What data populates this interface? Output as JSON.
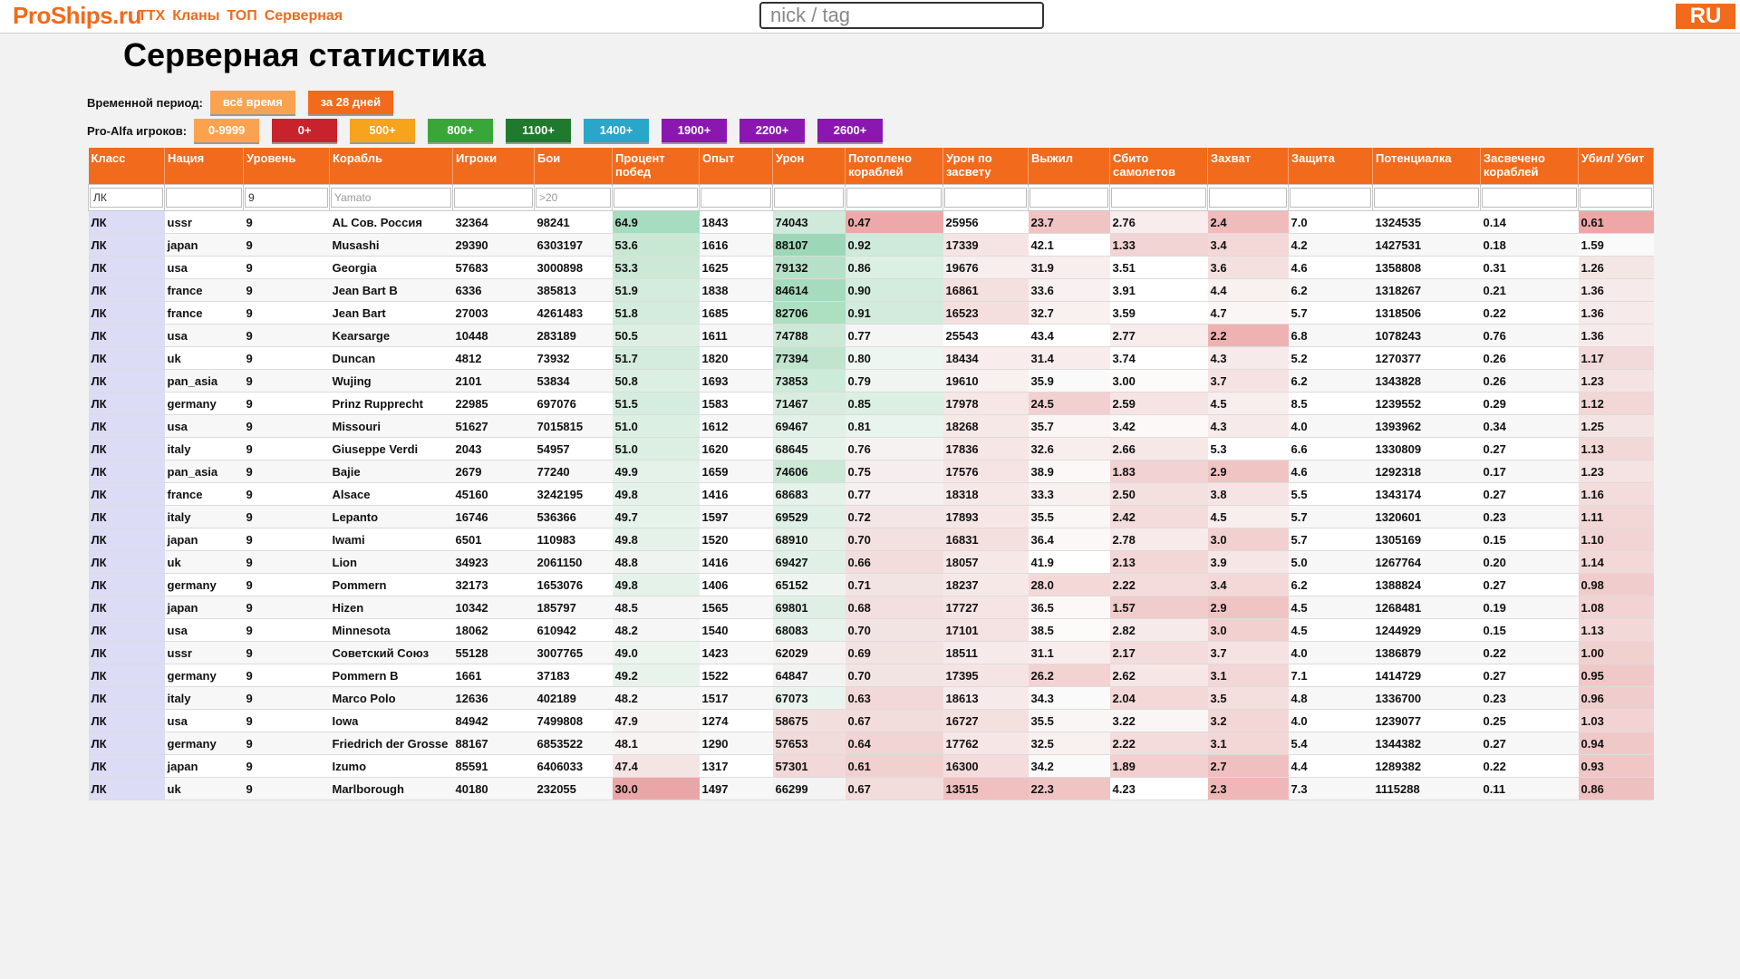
{
  "header": {
    "logo": "ProShips.ru",
    "nav": [
      "ТТХ",
      "Кланы",
      "ТОП",
      "Серверная"
    ],
    "search_placeholder": "nick / tag",
    "lang": "RU"
  },
  "page_title": "Серверная статистика",
  "period": {
    "label": "Временной период:",
    "buttons": [
      {
        "label": "всё время",
        "color": "#f9a350"
      },
      {
        "label": "за 28 дней",
        "color": "#f26a1b"
      }
    ]
  },
  "alfa": {
    "label": "Pro-Alfa игроков:",
    "buttons": [
      {
        "label": "0-9999",
        "color": "#f9a350"
      },
      {
        "label": "0+",
        "color": "#c8232c"
      },
      {
        "label": "500+",
        "color": "#f7a31b"
      },
      {
        "label": "800+",
        "color": "#3aa63a"
      },
      {
        "label": "1100+",
        "color": "#1f7a2e"
      },
      {
        "label": "1400+",
        "color": "#2aa6c9"
      },
      {
        "label": "1900+",
        "color": "#8a18b0"
      },
      {
        "label": "2200+",
        "color": "#8a18b0"
      },
      {
        "label": "2600+",
        "color": "#8a18b0"
      }
    ]
  },
  "table": {
    "columns": [
      "Класс",
      "Нация",
      "Уровень",
      "Корабль",
      "Игроки",
      "Бои",
      "Процент побед",
      "Опыт",
      "Урон",
      "Потоплено кораблей",
      "Урон по засвету",
      "Выжил",
      "Сбито самолетов",
      "Захват",
      "Защита",
      "Потенциалка",
      "Засвечено кораблей",
      "Убил/ Убит"
    ],
    "filters": [
      "ЛК",
      "",
      "9",
      "",
      "",
      "",
      "",
      "",
      "",
      "",
      "",
      "",
      "",
      "",
      "",
      "",
      "",
      ""
    ],
    "filter_placeholders": [
      "",
      "",
      "",
      "Yamato",
      "",
      ">20",
      "",
      "",
      "",
      "",
      "",
      "",
      "",
      "",
      "",
      "",
      "",
      ""
    ],
    "rows": [
      [
        "ЛК",
        "ussr",
        "9",
        "AL Сов. Россия",
        "32364",
        "98241",
        "64.9",
        "1843",
        "74043",
        "0.47",
        "25956",
        "23.7",
        "2.76",
        "2.4",
        "7.0",
        "1324535",
        "0.14",
        "0.61"
      ],
      [
        "ЛК",
        "japan",
        "9",
        "Musashi",
        "29390",
        "6303197",
        "53.6",
        "1616",
        "88107",
        "0.92",
        "17339",
        "42.1",
        "1.33",
        "3.4",
        "4.2",
        "1427531",
        "0.18",
        "1.59"
      ],
      [
        "ЛК",
        "usa",
        "9",
        "Georgia",
        "57683",
        "3000898",
        "53.3",
        "1625",
        "79132",
        "0.86",
        "19676",
        "31.9",
        "3.51",
        "3.6",
        "4.6",
        "1358808",
        "0.31",
        "1.26"
      ],
      [
        "ЛК",
        "france",
        "9",
        "Jean Bart B",
        "6336",
        "385813",
        "51.9",
        "1838",
        "84614",
        "0.90",
        "16861",
        "33.6",
        "3.91",
        "4.4",
        "6.2",
        "1318267",
        "0.21",
        "1.36"
      ],
      [
        "ЛК",
        "france",
        "9",
        "Jean Bart",
        "27003",
        "4261483",
        "51.8",
        "1685",
        "82706",
        "0.91",
        "16523",
        "32.7",
        "3.59",
        "4.7",
        "5.7",
        "1318506",
        "0.22",
        "1.36"
      ],
      [
        "ЛК",
        "usa",
        "9",
        "Kearsarge",
        "10448",
        "283189",
        "50.5",
        "1611",
        "74788",
        "0.77",
        "25543",
        "43.4",
        "2.77",
        "2.2",
        "6.8",
        "1078243",
        "0.76",
        "1.36"
      ],
      [
        "ЛК",
        "uk",
        "9",
        "Duncan",
        "4812",
        "73932",
        "51.7",
        "1820",
        "77394",
        "0.80",
        "18434",
        "31.4",
        "3.74",
        "4.3",
        "5.2",
        "1270377",
        "0.26",
        "1.17"
      ],
      [
        "ЛК",
        "pan_asia",
        "9",
        "Wujing",
        "2101",
        "53834",
        "50.8",
        "1693",
        "73853",
        "0.79",
        "19610",
        "35.9",
        "3.00",
        "3.7",
        "6.2",
        "1343828",
        "0.26",
        "1.23"
      ],
      [
        "ЛК",
        "germany",
        "9",
        "Prinz Rupprecht",
        "22985",
        "697076",
        "51.5",
        "1583",
        "71467",
        "0.85",
        "17978",
        "24.5",
        "2.59",
        "4.5",
        "8.5",
        "1239552",
        "0.29",
        "1.12"
      ],
      [
        "ЛК",
        "usa",
        "9",
        "Missouri",
        "51627",
        "7015815",
        "51.0",
        "1612",
        "69467",
        "0.81",
        "18268",
        "35.7",
        "3.42",
        "4.3",
        "4.0",
        "1393962",
        "0.34",
        "1.25"
      ],
      [
        "ЛК",
        "italy",
        "9",
        "Giuseppe Verdi",
        "2043",
        "54957",
        "51.0",
        "1620",
        "68645",
        "0.76",
        "17836",
        "32.6",
        "2.66",
        "5.3",
        "6.6",
        "1330809",
        "0.27",
        "1.13"
      ],
      [
        "ЛК",
        "pan_asia",
        "9",
        "Bajie",
        "2679",
        "77240",
        "49.9",
        "1659",
        "74606",
        "0.75",
        "17576",
        "38.9",
        "1.83",
        "2.9",
        "4.6",
        "1292318",
        "0.17",
        "1.23"
      ],
      [
        "ЛК",
        "france",
        "9",
        "Alsace",
        "45160",
        "3242195",
        "49.8",
        "1416",
        "68683",
        "0.77",
        "18318",
        "33.3",
        "2.50",
        "3.8",
        "5.5",
        "1343174",
        "0.27",
        "1.16"
      ],
      [
        "ЛК",
        "italy",
        "9",
        "Lepanto",
        "16746",
        "536366",
        "49.7",
        "1597",
        "69529",
        "0.72",
        "17893",
        "35.5",
        "2.42",
        "4.5",
        "5.7",
        "1320601",
        "0.23",
        "1.11"
      ],
      [
        "ЛК",
        "japan",
        "9",
        "Iwami",
        "6501",
        "110983",
        "49.8",
        "1520",
        "68910",
        "0.70",
        "16831",
        "36.4",
        "2.78",
        "3.0",
        "5.7",
        "1305169",
        "0.15",
        "1.10"
      ],
      [
        "ЛК",
        "uk",
        "9",
        "Lion",
        "34923",
        "2061150",
        "48.8",
        "1416",
        "69427",
        "0.66",
        "18057",
        "41.9",
        "2.13",
        "3.9",
        "5.0",
        "1267764",
        "0.20",
        "1.14"
      ],
      [
        "ЛК",
        "germany",
        "9",
        "Pommern",
        "32173",
        "1653076",
        "49.8",
        "1406",
        "65152",
        "0.71",
        "18237",
        "28.0",
        "2.22",
        "3.4",
        "6.2",
        "1388824",
        "0.27",
        "0.98"
      ],
      [
        "ЛК",
        "japan",
        "9",
        "Hizen",
        "10342",
        "185797",
        "48.5",
        "1565",
        "69801",
        "0.68",
        "17727",
        "36.5",
        "1.57",
        "2.9",
        "4.5",
        "1268481",
        "0.19",
        "1.08"
      ],
      [
        "ЛК",
        "usa",
        "9",
        "Minnesota",
        "18062",
        "610942",
        "48.2",
        "1540",
        "68083",
        "0.70",
        "17101",
        "38.5",
        "2.82",
        "3.0",
        "4.5",
        "1244929",
        "0.15",
        "1.13"
      ],
      [
        "ЛК",
        "ussr",
        "9",
        "Советский Союз",
        "55128",
        "3007765",
        "49.0",
        "1423",
        "62029",
        "0.69",
        "18511",
        "31.1",
        "2.17",
        "3.7",
        "4.0",
        "1386879",
        "0.22",
        "1.00"
      ],
      [
        "ЛК",
        "germany",
        "9",
        "Pommern B",
        "1661",
        "37183",
        "49.2",
        "1522",
        "64847",
        "0.70",
        "17395",
        "26.2",
        "2.62",
        "3.1",
        "7.1",
        "1414729",
        "0.27",
        "0.95"
      ],
      [
        "ЛК",
        "italy",
        "9",
        "Marco Polo",
        "12636",
        "402189",
        "48.2",
        "1517",
        "67073",
        "0.63",
        "18613",
        "34.3",
        "2.04",
        "3.5",
        "4.8",
        "1336700",
        "0.23",
        "0.96"
      ],
      [
        "ЛК",
        "usa",
        "9",
        "Iowa",
        "84942",
        "7499808",
        "47.9",
        "1274",
        "58675",
        "0.67",
        "16727",
        "35.5",
        "3.22",
        "3.2",
        "4.0",
        "1239077",
        "0.25",
        "1.03"
      ],
      [
        "ЛК",
        "germany",
        "9",
        "Friedrich der Grosse",
        "88167",
        "6853522",
        "48.1",
        "1290",
        "57653",
        "0.64",
        "17762",
        "32.5",
        "2.22",
        "3.1",
        "5.4",
        "1344382",
        "0.27",
        "0.94"
      ],
      [
        "ЛК",
        "japan",
        "9",
        "Izumo",
        "85591",
        "6406033",
        "47.4",
        "1317",
        "57301",
        "0.61",
        "16300",
        "34.2",
        "1.89",
        "2.7",
        "4.4",
        "1289382",
        "0.22",
        "0.93"
      ],
      [
        "ЛК",
        "uk",
        "9",
        "Marlborough",
        "40180",
        "232055",
        "30.0",
        "1497",
        "66299",
        "0.67",
        "13515",
        "22.3",
        "4.23",
        "2.3",
        "7.3",
        "1115288",
        "0.11",
        "0.86"
      ]
    ],
    "cell_colors": {
      "6": [
        "#a6dcc0",
        "#c8e8d4",
        "#cbe9d6",
        "#d3ecdd",
        "#d3ecdd",
        "#dcefe2",
        "#d3ecdd",
        "#dbefe3",
        "#d5ede0",
        "#dbefe3",
        "#dbefe3",
        "#e4f2e9",
        "#e5f2ea",
        "#e6f3eb",
        "#e5f2ea",
        "#f0f4f0",
        "#e5f2ea",
        "#f5f5f5",
        "#f6f6f6",
        "#ecf4ee",
        "#e8f3ec",
        "#f6f6f6",
        "#f8f3f3",
        "#f8f3f3",
        "#f5e4e4",
        "#eaa6a6"
      ],
      "8": [
        "#cfe9da",
        "#9cd7b8",
        "#b6e1c8",
        "#a7dbbd",
        "#ace0c1",
        "#cce8d6",
        "#c0e4ce",
        "#ccebd8",
        "#d8ece0",
        "#e2f1e8",
        "#e6f3eb",
        "#cce8d6",
        "#e4f2e9",
        "#dff0e6",
        "#e3f1e8",
        "#e1f0e7",
        "#eef5f0",
        "#dfefe6",
        "#e7f3ec",
        "#f7f2f2",
        "#f3f3f3",
        "#eaf4ee",
        "#f3dede",
        "#f2dbdb",
        "#f2d8d8",
        "#f3f3f3"
      ],
      "9": [
        "#eda9a9",
        "#cfe9da",
        "#dbefe3",
        "#d3ecdd",
        "#d2ebdc",
        "#f5f5f5",
        "#eef6f1",
        "#f1f5f2",
        "#dcefe3",
        "#eaf4ee",
        "#f6f2f2",
        "#f6eeee",
        "#f6f0f0",
        "#f4e6e6",
        "#f3e0e0",
        "#f2dcdc",
        "#f3e4e4",
        "#f3dfdf",
        "#f3e4e4",
        "#f3e2e2",
        "#f3e4e4",
        "#f2d8d8",
        "#f2dcdc",
        "#f2d4d4",
        "#f1d0d0",
        "#f2dcdc"
      ],
      "10": [
        "#ffffff",
        "#f6e4e4",
        "#f8eeee",
        "#f5e0e0",
        "#f5dede",
        "#ffffff",
        "#f8ecec",
        "#f9f0f0",
        "#f6e6e6",
        "#f7e8e8",
        "#f6e6e6",
        "#f6e4e4",
        "#f7e8e8",
        "#f6e6e6",
        "#f5e0e0",
        "#f7e8e8",
        "#f7e8e8",
        "#f6e4e4",
        "#f5e2e2",
        "#f7eaea",
        "#f6e4e4",
        "#f7eaea",
        "#f5e0e0",
        "#f6e6e6",
        "#f4dcdc",
        "#f0c0c0"
      ],
      "11": [
        "#f1c4c4",
        "#ffffff",
        "#f8eeee",
        "#f9f1f1",
        "#f9f0f0",
        "#ffffff",
        "#f8ecec",
        "#fafafa",
        "#f3d0d0",
        "#fbf5f5",
        "#f9eeee",
        "#fcf8f8",
        "#f9f0f0",
        "#fbf6f6",
        "#fcf8f8",
        "#ffffff",
        "#f4d8d8",
        "#fcf8f8",
        "#fdfafa",
        "#f8ecec",
        "#f3d2d2",
        "#fafafa",
        "#fbf6f6",
        "#f9f0f0",
        "#fafafa",
        "#f1c4c4"
      ],
      "12": [
        "#f8ecec",
        "#f2d4d4",
        "#ffffff",
        "#ffffff",
        "#ffffff",
        "#f8ecec",
        "#ffffff",
        "#fdfafa",
        "#f6e4e4",
        "#fcf8f8",
        "#f7e8e8",
        "#f2d2d2",
        "#f5e0e0",
        "#f4dcdc",
        "#f8eaea",
        "#f3d6d6",
        "#f4dcdc",
        "#f1cccc",
        "#f7eaea",
        "#f4dcdc",
        "#f6e6e6",
        "#f4d8d8",
        "#faf6f6",
        "#f4dcdc",
        "#f2d0d0",
        "#ffffff"
      ],
      "13": [
        "#efbbbb",
        "#f4d8d8",
        "#f5e0e0",
        "#f9f0f0",
        "#fbf6f6",
        "#eeb2b2",
        "#f7eaea",
        "#f6e2e2",
        "#f8eeee",
        "#f7eaea",
        "#ffffff",
        "#f1c4c4",
        "#f6e4e4",
        "#f8eeee",
        "#f2d0d0",
        "#f6e6e6",
        "#f4d8d8",
        "#f1c4c4",
        "#f2d0d0",
        "#f6e2e2",
        "#f3d6d6",
        "#f5dede",
        "#f3d6d6",
        "#f3d6d6",
        "#f0c0c0",
        "#efb7b7"
      ],
      "17": [
        "#eea6a6",
        "#fafafa",
        "#f5e6e6",
        "#f7eaea",
        "#f7eaea",
        "#f7eaea",
        "#f3dada",
        "#f5e2e2",
        "#f3d6d6",
        "#f5e4e4",
        "#f3d8d8",
        "#f5e2e2",
        "#f4dcdc",
        "#f3d6d6",
        "#f2d4d4",
        "#f4d8d8",
        "#f1cccc",
        "#f2d2d2",
        "#f3d8d8",
        "#f1d0d0",
        "#f0c8c8",
        "#f0cccc",
        "#f2d2d2",
        "#f0c8c8",
        "#f0c6c6",
        "#efc0c0"
      ]
    }
  }
}
